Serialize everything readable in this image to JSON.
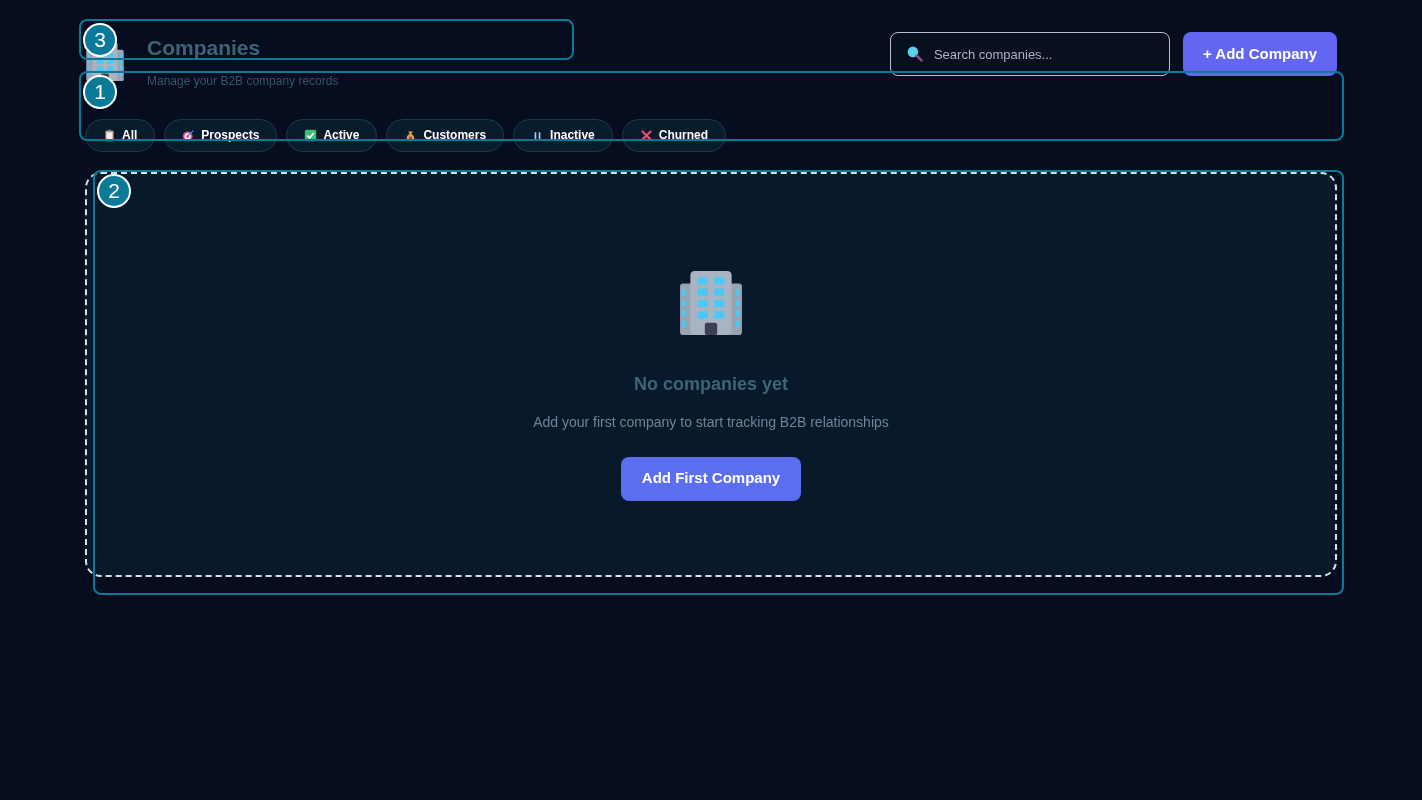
{
  "header": {
    "title": "Companies",
    "subtitle": "Manage your B2B company records"
  },
  "search": {
    "placeholder": "Search companies..."
  },
  "add_button": "+ Add Company",
  "filters": [
    {
      "kind": "clipboard",
      "label": "All"
    },
    {
      "kind": "target",
      "label": "Prospects"
    },
    {
      "kind": "check",
      "label": "Active"
    },
    {
      "kind": "moneybag",
      "label": "Customers"
    },
    {
      "kind": "pause",
      "label": "Inactive"
    },
    {
      "kind": "cross",
      "label": "Churned"
    }
  ],
  "empty_state": {
    "title": "No companies yet",
    "message": "Add your first company to start tracking B2B relationships",
    "button": "Add First Company"
  },
  "highlights": [
    {
      "kind": "header",
      "number": "3"
    },
    {
      "kind": "filters",
      "number": "1"
    },
    {
      "kind": "content",
      "number": "2"
    }
  ]
}
